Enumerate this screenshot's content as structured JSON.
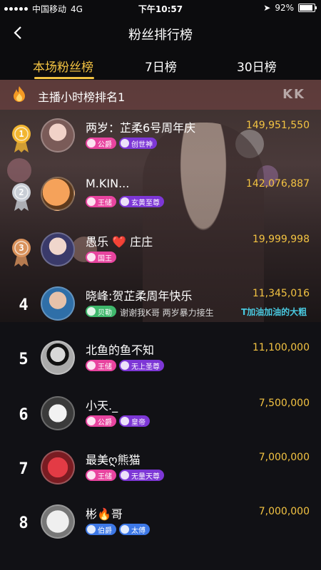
{
  "status_bar": {
    "carrier": "中国移动",
    "network": "4G",
    "time": "下午10:57",
    "battery_percent": "92%"
  },
  "nav": {
    "title": "粉丝排行榜"
  },
  "tabs": [
    {
      "label": "本场粉丝榜",
      "active": true
    },
    {
      "label": "7日榜",
      "active": false
    },
    {
      "label": "30日榜",
      "active": false
    }
  ],
  "banner": {
    "text": "主播小时榜排名1",
    "watermark": "KK"
  },
  "overlay_caption": {
    "left_text": "谢谢我K哥 两岁暴力接生",
    "right_text": "T加油加油的大粗"
  },
  "rows": [
    {
      "rank": "1",
      "name": "两岁：芷柔6号周年庆",
      "score": "149,951,550",
      "badges": [
        {
          "label": "公爵",
          "color": "pink"
        },
        {
          "label": "创世神",
          "color": "purple"
        }
      ]
    },
    {
      "rank": "2",
      "name": "M.KIN...",
      "score": "142,076,887",
      "badges": [
        {
          "label": "王储",
          "color": "pink"
        },
        {
          "label": "玄黄至尊",
          "color": "purple"
        }
      ]
    },
    {
      "rank": "3",
      "name": "愚乐 ❤️ 庄庄",
      "score": "19,999,998",
      "badges": [
        {
          "label": "国王",
          "color": "pink"
        }
      ]
    },
    {
      "rank": "4",
      "name": "晓峰:贺芷柔周年快乐",
      "score": "11,345,016",
      "badges": [
        {
          "label": "贝勒",
          "color": "green"
        }
      ]
    },
    {
      "rank": "5",
      "name": "北鱼的鱼不知",
      "score": "11,100,000",
      "badges": [
        {
          "label": "王储",
          "color": "pink"
        },
        {
          "label": "无上圣尊",
          "color": "purple"
        }
      ]
    },
    {
      "rank": "6",
      "name": "小天._",
      "score": "7,500,000",
      "badges": [
        {
          "label": "公爵",
          "color": "pink"
        },
        {
          "label": "皇帝",
          "color": "purple"
        }
      ]
    },
    {
      "rank": "7",
      "name": "最美ღ熊猫",
      "score": "7,000,000",
      "badges": [
        {
          "label": "王储",
          "color": "pink"
        },
        {
          "label": "无量天尊",
          "color": "purple"
        }
      ]
    },
    {
      "rank": "8",
      "name": "彬🔥哥",
      "score": "7,000,000",
      "badges": [
        {
          "label": "伯爵",
          "color": "blue"
        },
        {
          "label": "太傅",
          "color": "blue"
        }
      ]
    }
  ],
  "colors": {
    "accent": "#f3c342",
    "background": "#111115"
  }
}
